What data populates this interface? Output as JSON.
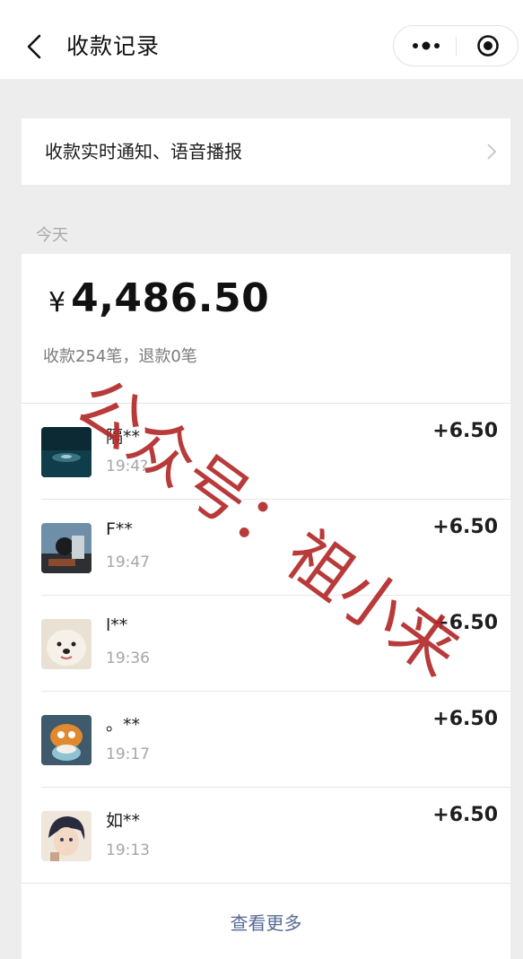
{
  "header": {
    "title": "收款记录",
    "back_icon": "chevron-left-icon",
    "more_icon": "more-dots-icon",
    "close_icon": "target-circle-icon"
  },
  "notice": {
    "label": "收款实时通知、语音播报",
    "icon": "chevron-right-icon"
  },
  "section": {
    "label": "今天"
  },
  "summary": {
    "currency": "¥",
    "amount": "4,486.50",
    "detail": "收款254笔，退款0笔"
  },
  "records": [
    {
      "name": "隔**",
      "time": "19:4?",
      "amount": "+6.50",
      "avatar": "sea-avatar"
    },
    {
      "name": "F**",
      "time": "19:47",
      "amount": "+6.50",
      "avatar": "pilot-avatar"
    },
    {
      "name": "l**",
      "time": "19:36",
      "amount": "+6.50",
      "avatar": "dog-avatar"
    },
    {
      "name": "。**",
      "time": "19:17",
      "amount": "+6.50",
      "avatar": "cat-avatar"
    },
    {
      "name": "如**",
      "time": "19:13",
      "amount": "+6.50",
      "avatar": "anime-avatar"
    }
  ],
  "view_more": "查看更多",
  "watermark": "公众号：祖小来",
  "colors": {
    "link": "#576b95",
    "watermark": "#b22a2a",
    "background": "#ededed"
  }
}
